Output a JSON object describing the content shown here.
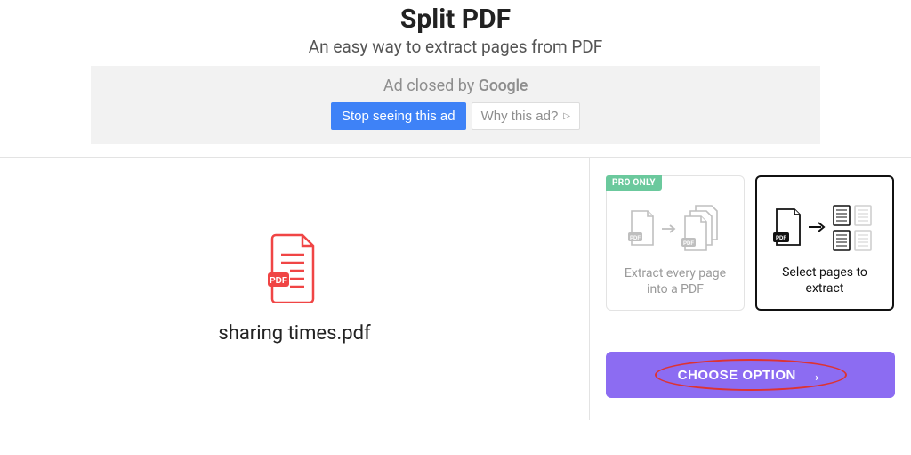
{
  "header": {
    "title": "Split PDF",
    "subtitle": "An easy way to extract pages from PDF"
  },
  "ad": {
    "closed_text": "Ad closed by ",
    "google": "Google",
    "stop_label": "Stop seeing this ad",
    "why_label": "Why this ad?"
  },
  "file": {
    "name": "sharing times.pdf",
    "badge": "PDF"
  },
  "options": {
    "pro_tag": "PRO ONLY",
    "extract_every": "Extract every page into a PDF",
    "select_pages": "Select pages to extract",
    "card_badge": "PDF"
  },
  "cta": {
    "label": "CHOOSE OPTION"
  }
}
